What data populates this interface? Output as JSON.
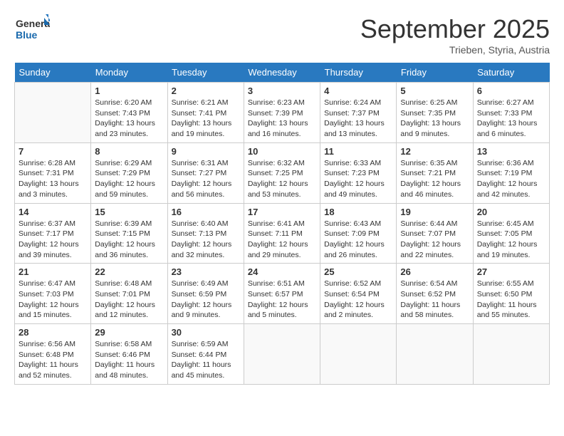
{
  "header": {
    "logo_general": "General",
    "logo_blue": "Blue",
    "month_title": "September 2025",
    "subtitle": "Trieben, Styria, Austria"
  },
  "days_of_week": [
    "Sunday",
    "Monday",
    "Tuesday",
    "Wednesday",
    "Thursday",
    "Friday",
    "Saturday"
  ],
  "weeks": [
    [
      {
        "day": "",
        "info": ""
      },
      {
        "day": "1",
        "info": "Sunrise: 6:20 AM\nSunset: 7:43 PM\nDaylight: 13 hours\nand 23 minutes."
      },
      {
        "day": "2",
        "info": "Sunrise: 6:21 AM\nSunset: 7:41 PM\nDaylight: 13 hours\nand 19 minutes."
      },
      {
        "day": "3",
        "info": "Sunrise: 6:23 AM\nSunset: 7:39 PM\nDaylight: 13 hours\nand 16 minutes."
      },
      {
        "day": "4",
        "info": "Sunrise: 6:24 AM\nSunset: 7:37 PM\nDaylight: 13 hours\nand 13 minutes."
      },
      {
        "day": "5",
        "info": "Sunrise: 6:25 AM\nSunset: 7:35 PM\nDaylight: 13 hours\nand 9 minutes."
      },
      {
        "day": "6",
        "info": "Sunrise: 6:27 AM\nSunset: 7:33 PM\nDaylight: 13 hours\nand 6 minutes."
      }
    ],
    [
      {
        "day": "7",
        "info": "Sunrise: 6:28 AM\nSunset: 7:31 PM\nDaylight: 13 hours\nand 3 minutes."
      },
      {
        "day": "8",
        "info": "Sunrise: 6:29 AM\nSunset: 7:29 PM\nDaylight: 12 hours\nand 59 minutes."
      },
      {
        "day": "9",
        "info": "Sunrise: 6:31 AM\nSunset: 7:27 PM\nDaylight: 12 hours\nand 56 minutes."
      },
      {
        "day": "10",
        "info": "Sunrise: 6:32 AM\nSunset: 7:25 PM\nDaylight: 12 hours\nand 53 minutes."
      },
      {
        "day": "11",
        "info": "Sunrise: 6:33 AM\nSunset: 7:23 PM\nDaylight: 12 hours\nand 49 minutes."
      },
      {
        "day": "12",
        "info": "Sunrise: 6:35 AM\nSunset: 7:21 PM\nDaylight: 12 hours\nand 46 minutes."
      },
      {
        "day": "13",
        "info": "Sunrise: 6:36 AM\nSunset: 7:19 PM\nDaylight: 12 hours\nand 42 minutes."
      }
    ],
    [
      {
        "day": "14",
        "info": "Sunrise: 6:37 AM\nSunset: 7:17 PM\nDaylight: 12 hours\nand 39 minutes."
      },
      {
        "day": "15",
        "info": "Sunrise: 6:39 AM\nSunset: 7:15 PM\nDaylight: 12 hours\nand 36 minutes."
      },
      {
        "day": "16",
        "info": "Sunrise: 6:40 AM\nSunset: 7:13 PM\nDaylight: 12 hours\nand 32 minutes."
      },
      {
        "day": "17",
        "info": "Sunrise: 6:41 AM\nSunset: 7:11 PM\nDaylight: 12 hours\nand 29 minutes."
      },
      {
        "day": "18",
        "info": "Sunrise: 6:43 AM\nSunset: 7:09 PM\nDaylight: 12 hours\nand 26 minutes."
      },
      {
        "day": "19",
        "info": "Sunrise: 6:44 AM\nSunset: 7:07 PM\nDaylight: 12 hours\nand 22 minutes."
      },
      {
        "day": "20",
        "info": "Sunrise: 6:45 AM\nSunset: 7:05 PM\nDaylight: 12 hours\nand 19 minutes."
      }
    ],
    [
      {
        "day": "21",
        "info": "Sunrise: 6:47 AM\nSunset: 7:03 PM\nDaylight: 12 hours\nand 15 minutes."
      },
      {
        "day": "22",
        "info": "Sunrise: 6:48 AM\nSunset: 7:01 PM\nDaylight: 12 hours\nand 12 minutes."
      },
      {
        "day": "23",
        "info": "Sunrise: 6:49 AM\nSunset: 6:59 PM\nDaylight: 12 hours\nand 9 minutes."
      },
      {
        "day": "24",
        "info": "Sunrise: 6:51 AM\nSunset: 6:57 PM\nDaylight: 12 hours\nand 5 minutes."
      },
      {
        "day": "25",
        "info": "Sunrise: 6:52 AM\nSunset: 6:54 PM\nDaylight: 12 hours\nand 2 minutes."
      },
      {
        "day": "26",
        "info": "Sunrise: 6:54 AM\nSunset: 6:52 PM\nDaylight: 11 hours\nand 58 minutes."
      },
      {
        "day": "27",
        "info": "Sunrise: 6:55 AM\nSunset: 6:50 PM\nDaylight: 11 hours\nand 55 minutes."
      }
    ],
    [
      {
        "day": "28",
        "info": "Sunrise: 6:56 AM\nSunset: 6:48 PM\nDaylight: 11 hours\nand 52 minutes."
      },
      {
        "day": "29",
        "info": "Sunrise: 6:58 AM\nSunset: 6:46 PM\nDaylight: 11 hours\nand 48 minutes."
      },
      {
        "day": "30",
        "info": "Sunrise: 6:59 AM\nSunset: 6:44 PM\nDaylight: 11 hours\nand 45 minutes."
      },
      {
        "day": "",
        "info": ""
      },
      {
        "day": "",
        "info": ""
      },
      {
        "day": "",
        "info": ""
      },
      {
        "day": "",
        "info": ""
      }
    ]
  ]
}
